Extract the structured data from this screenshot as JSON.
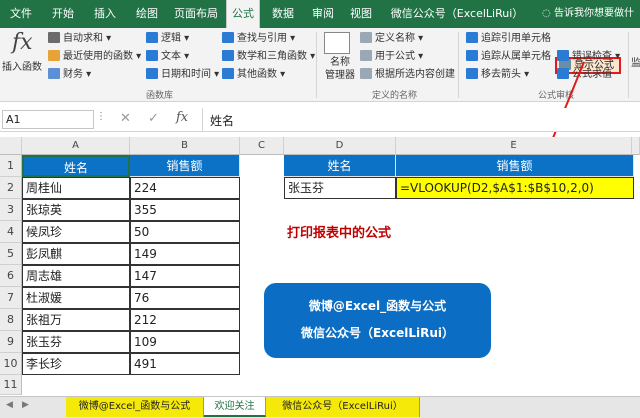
{
  "menu": {
    "tabs": [
      "文件",
      "开始",
      "插入",
      "绘图",
      "页面布局",
      "公式",
      "数据",
      "审阅",
      "视图",
      "微信公众号（ExcelLiRui）"
    ],
    "active_tab": "公式",
    "tell_me": "告诉我你想要做什么..."
  },
  "ribbon": {
    "insert_function": "插入函数",
    "library": [
      "自动求和",
      "最近使用的函数",
      "财务",
      "逻辑",
      "文本",
      "日期和时间",
      "查找与引用",
      "数学和三角函数",
      "其他函数"
    ],
    "library_label": "函数库",
    "name_manager": "名称\n管理器",
    "define_name": "定义名称",
    "use_in_formula": "用于公式",
    "create_from_selection": "根据所选内容创建",
    "defined_names_label": "定义的名称",
    "trace_precedents": "追踪引用单元格",
    "trace_dependents": "追踪从属单元格",
    "remove_arrows": "移去箭头",
    "show_formulas": "显示公式",
    "error_checking": "错误检查",
    "evaluate_formula": "公式求值",
    "auditing_label": "公式审核",
    "watch": "监"
  },
  "formula_bar": {
    "name_box": "A1",
    "fx": "fx",
    "content": "姓名"
  },
  "columns": [
    "A",
    "B",
    "C",
    "D",
    "E"
  ],
  "rows": [
    "1",
    "2",
    "3",
    "4",
    "5",
    "6",
    "7",
    "8",
    "9",
    "10",
    "11"
  ],
  "table_left": {
    "header": [
      "姓名",
      "销售额"
    ],
    "rows": [
      [
        "周桂仙",
        "224"
      ],
      [
        "张琼英",
        "355"
      ],
      [
        "候凤珍",
        "50"
      ],
      [
        "彭凤麒",
        "149"
      ],
      [
        "周志雄",
        "147"
      ],
      [
        "杜淑媛",
        "76"
      ],
      [
        "张祖万",
        "212"
      ],
      [
        "张玉芬",
        "109"
      ],
      [
        "李长珍",
        "491"
      ]
    ]
  },
  "table_right": {
    "header": [
      "姓名",
      "销售额"
    ],
    "name": "张玉芬",
    "formula": "=VLOOKUP(D2,$A$1:$B$10,2,0)"
  },
  "note": "打印报表中的公式",
  "banner": {
    "line1": "微博@Excel_函数与公式",
    "line2": "微信公众号（ExcelLiRui）"
  },
  "sheet_tabs": [
    "微博@Excel_函数与公式",
    "欢迎关注",
    "微信公众号（ExcelLiRui）"
  ],
  "colors": {
    "excel_green": "#217346",
    "header_blue": "#0b72c6",
    "formula_yellow": "#ffff00",
    "note_red": "#c00000",
    "highlight_red": "#e01b1b"
  }
}
